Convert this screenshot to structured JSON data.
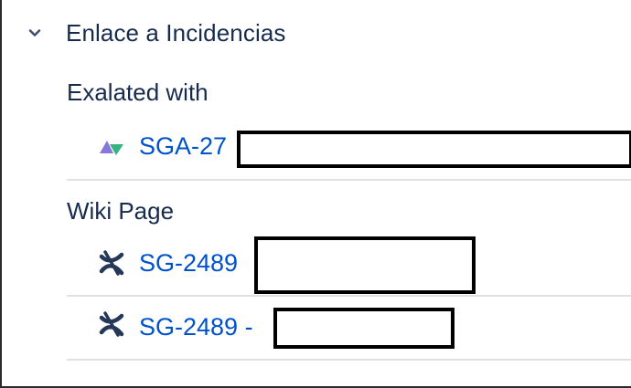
{
  "section": {
    "title": "Enlace a Incidencias",
    "expanded": true,
    "chevron_icon": "chevron-down-icon"
  },
  "groups": [
    {
      "label": "Exalated with",
      "items": [
        {
          "key": "SGA-27",
          "icon": "issue-type-icon"
        }
      ]
    },
    {
      "label": "Wiki Page",
      "items": [
        {
          "key": "SG-2489",
          "icon": "confluence-page-icon"
        },
        {
          "key": "SG-2489 -",
          "icon": "confluence-page-icon"
        }
      ]
    }
  ],
  "colors": {
    "link": "#0052cc",
    "text": "#172b4d",
    "divider": "#dfe1e6",
    "issue_icon_purple": "#8777d9",
    "issue_icon_green": "#36b37e",
    "confluence_icon": "#253858"
  }
}
